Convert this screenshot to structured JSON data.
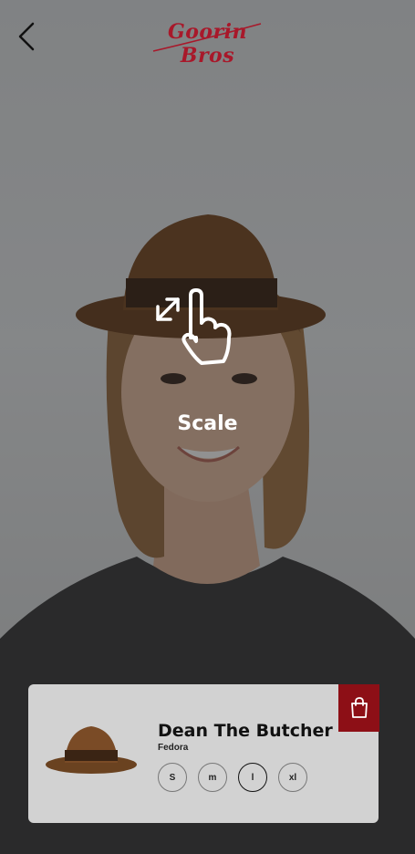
{
  "brand": {
    "name": "Goorin Bros",
    "color": "#a8182a"
  },
  "overlay": {
    "hint_label": "Scale",
    "icon": "pinch-scale-hand-icon"
  },
  "header": {
    "back_icon": "chevron-left-icon"
  },
  "product": {
    "name": "Dean The Butcher",
    "type": "Fedora",
    "sizes": [
      "S",
      "m",
      "l",
      "xl"
    ],
    "selected_size": "l"
  },
  "cart": {
    "icon": "shopping-bag-icon",
    "color": "#8d0f16"
  }
}
